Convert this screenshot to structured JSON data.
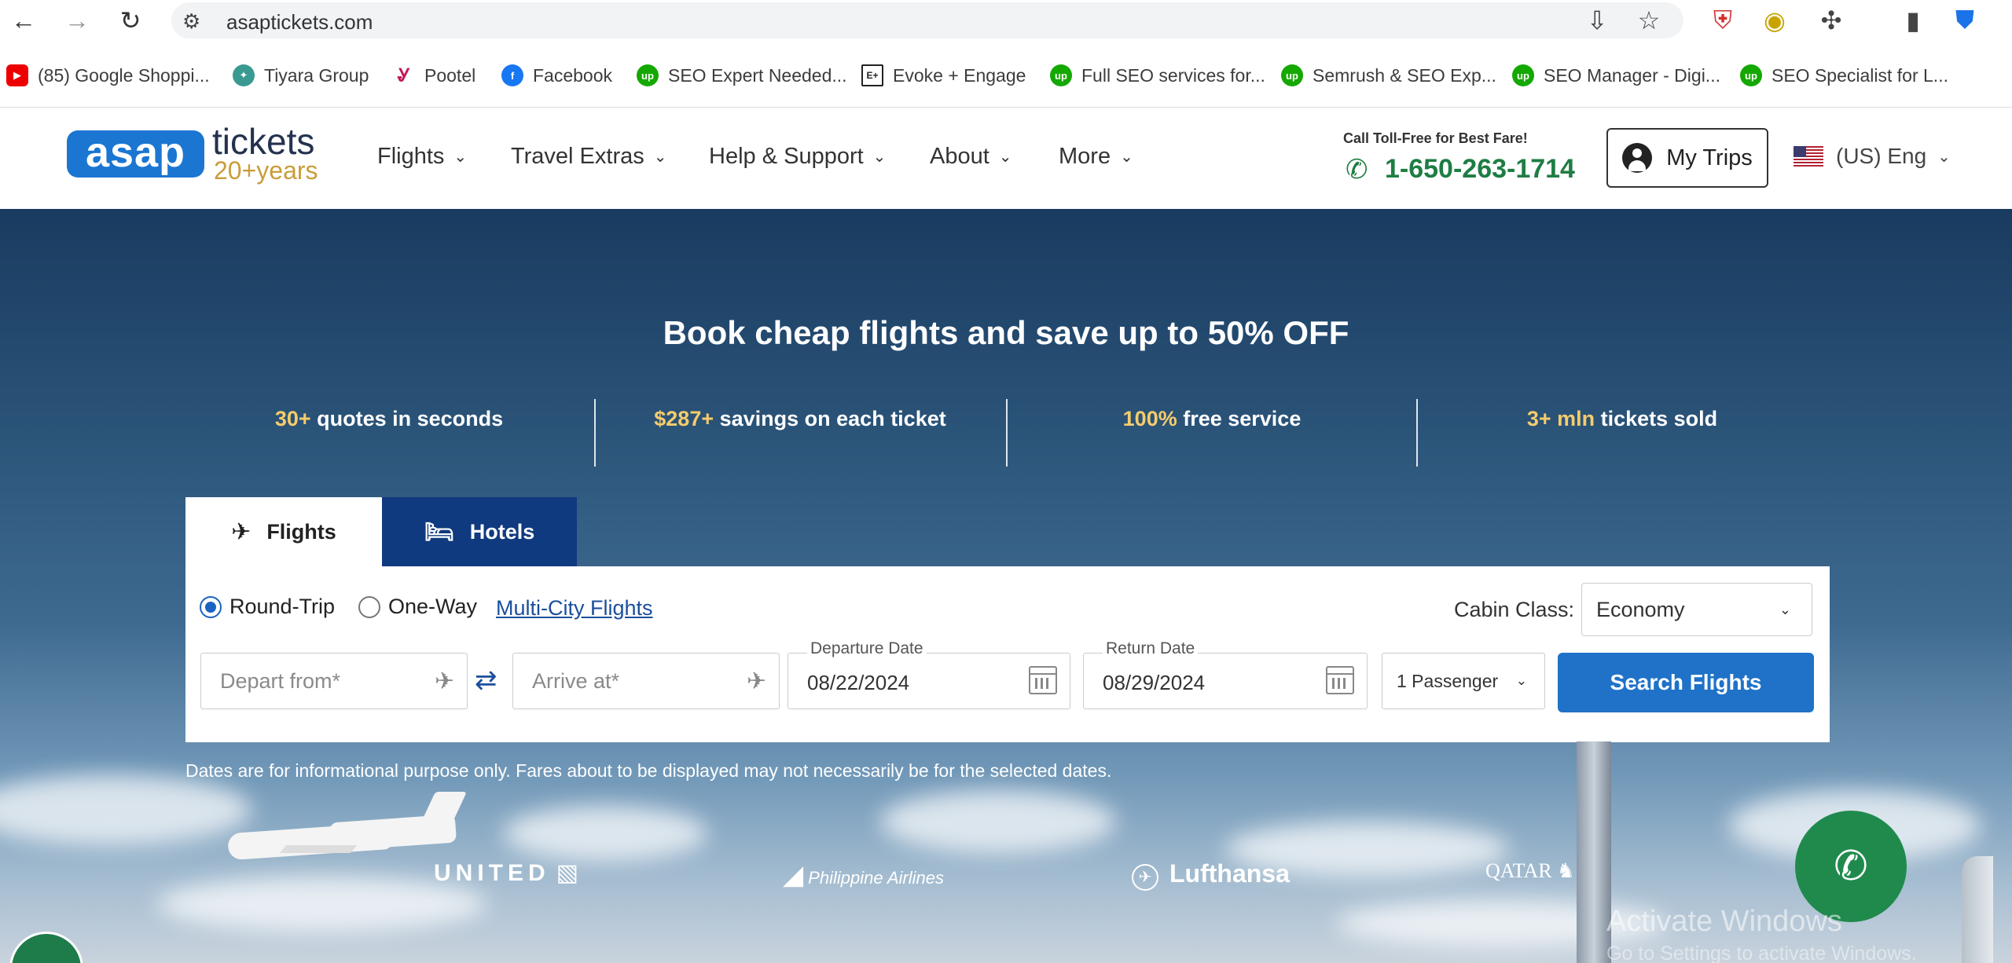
{
  "browser": {
    "url": "asaptickets.com",
    "bookmarks": [
      {
        "label": "(85) Google Shoppi...",
        "icon": "youtube-icon"
      },
      {
        "label": "Tiyara Group",
        "icon": "tiyara-icon"
      },
      {
        "label": "Pootel",
        "icon": "pootel-icon"
      },
      {
        "label": "Facebook",
        "icon": "facebook-icon"
      },
      {
        "label": "SEO Expert Needed...",
        "icon": "upwork-icon"
      },
      {
        "label": "Evoke + Engage",
        "icon": "evoke-icon"
      },
      {
        "label": "Full SEO services for...",
        "icon": "upwork-icon"
      },
      {
        "label": "Semrush & SEO Exp...",
        "icon": "upwork-icon"
      },
      {
        "label": "SEO Manager - Digi...",
        "icon": "upwork-icon"
      },
      {
        "label": "SEO Specialist for L...",
        "icon": "upwork-icon"
      }
    ]
  },
  "header": {
    "logo_main": "asap",
    "logo_tickets": "tickets",
    "logo_years": "20+years",
    "nav": [
      {
        "label": "Flights"
      },
      {
        "label": "Travel Extras"
      },
      {
        "label": "Help & Support"
      },
      {
        "label": "About"
      },
      {
        "label": "More"
      }
    ],
    "call_label": "Call Toll-Free for Best Fare!",
    "phone": "1-650-263-1714",
    "my_trips": "My Trips",
    "language": "(US) Eng"
  },
  "hero": {
    "title": "Book cheap flights and save up to 50% OFF",
    "stats": [
      {
        "highlight": "30+",
        "text": " quotes in seconds"
      },
      {
        "highlight": "$287+",
        "text": " savings on each ticket"
      },
      {
        "highlight": "100%",
        "text": " free service"
      },
      {
        "highlight": "3+ mln",
        "text": " tickets sold"
      }
    ]
  },
  "search": {
    "tabs": [
      {
        "label": "Flights",
        "active": true
      },
      {
        "label": "Hotels",
        "active": false
      }
    ],
    "trip_types": [
      {
        "label": "Round-Trip",
        "selected": true
      },
      {
        "label": "One-Way",
        "selected": false
      }
    ],
    "multi_city": "Multi-City Flights",
    "cabin_label": "Cabin Class:",
    "cabin_value": "Economy",
    "depart_placeholder": "Depart from*",
    "arrive_placeholder": "Arrive at*",
    "departure_label": "Departure Date",
    "departure_value": "08/22/2024",
    "return_label": "Return Date",
    "return_value": "08/29/2024",
    "passengers": "1 Passenger",
    "search_button": "Search Flights"
  },
  "disclaimer": "Dates are for informational purpose only. Fares about to be displayed may not necessarily be for the selected dates.",
  "airlines": [
    "UNITED",
    "Philippine Airlines",
    "Lufthansa",
    "QATAR"
  ],
  "windows": {
    "activate_title": "Activate Windows",
    "activate_sub": "Go to Settings to activate Windows."
  }
}
